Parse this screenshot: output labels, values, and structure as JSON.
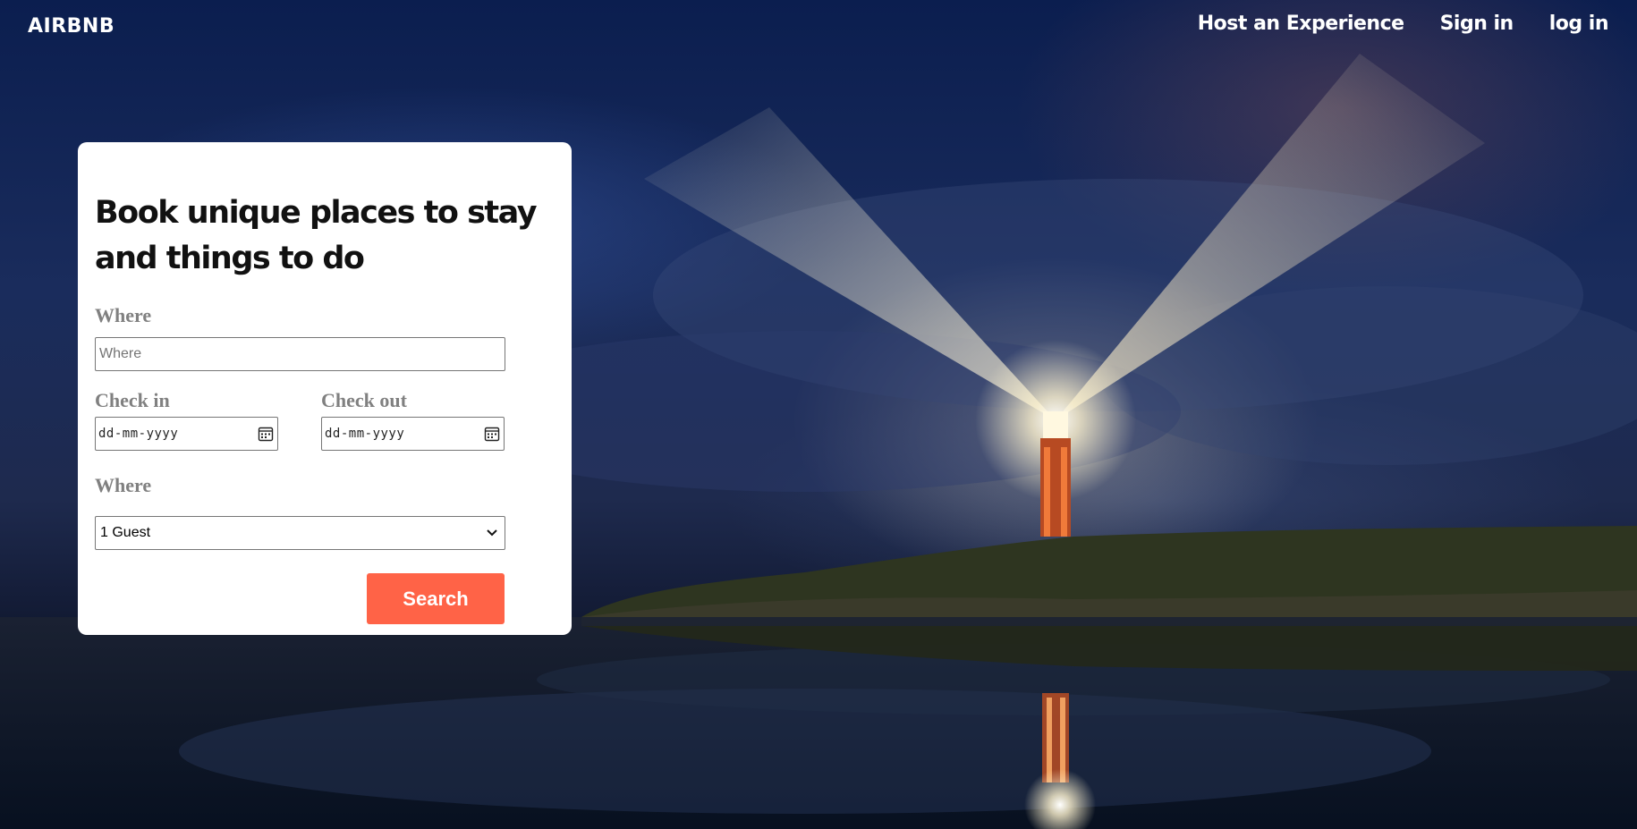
{
  "header": {
    "brand": "AIRBNB",
    "nav": [
      {
        "label": "Host an Experience"
      },
      {
        "label": "Sign in"
      },
      {
        "label": "log in"
      }
    ]
  },
  "booking": {
    "title": "Book unique places to stay and things to do",
    "where_label": "Where",
    "where_placeholder": "Where",
    "checkin_label": "Check in",
    "checkin_value": "dd-mm-yyyy",
    "checkout_label": "Check out",
    "checkout_value": "dd-mm-yyyy",
    "guests_label": "Where",
    "guests_selected": "1 Guest",
    "search_label": "Search"
  },
  "colors": {
    "accent": "#ff6347",
    "label_gray": "#808080",
    "sky": "#0b1e4f"
  },
  "icons": {
    "calendar": "calendar-icon",
    "chevron": "chevron-down-icon"
  }
}
